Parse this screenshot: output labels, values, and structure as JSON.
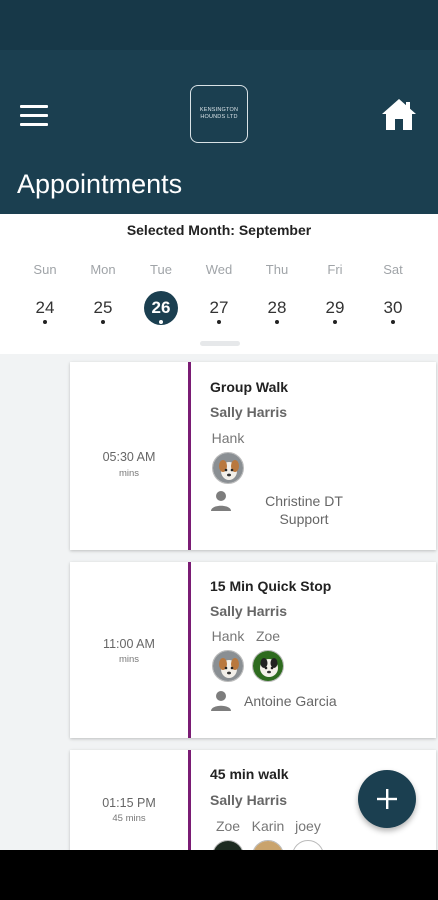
{
  "header": {
    "logo_text": "KENSINGTON HOUNDS LTD",
    "page_title": "Appointments"
  },
  "calendar": {
    "selected_month": "Selected Month: September",
    "day_names": [
      "Sun",
      "Mon",
      "Tue",
      "Wed",
      "Thu",
      "Fri",
      "Sat"
    ],
    "dates": [
      "24",
      "25",
      "26",
      "27",
      "28",
      "29",
      "30"
    ],
    "selected_date": "26"
  },
  "appointments": [
    {
      "time": "05:30 AM",
      "duration": "mins",
      "title": "Group Walk",
      "client": "Sally Harris",
      "pets": [
        {
          "name": "Hank"
        }
      ],
      "staff": "Christine DT Support"
    },
    {
      "time": "11:00 AM",
      "duration": "mins",
      "title": "15 Min Quick Stop",
      "client": "Sally Harris",
      "pets": [
        {
          "name": "Hank"
        },
        {
          "name": "Zoe"
        }
      ],
      "staff": "Antoine Garcia"
    },
    {
      "time": "01:15 PM",
      "duration": "45 mins",
      "title": "45 min walk",
      "client": "Sally Harris",
      "pets": [
        {
          "name": "Zoe"
        },
        {
          "name": "Karin"
        },
        {
          "name": "joey"
        }
      ],
      "staff": ""
    }
  ],
  "icons": {
    "menu": "hamburger-menu-icon",
    "home": "home-icon",
    "staff": "person-icon",
    "add": "plus-icon"
  },
  "colors": {
    "primary": "#1b3f50",
    "accent_divider": "#7a1c74"
  }
}
